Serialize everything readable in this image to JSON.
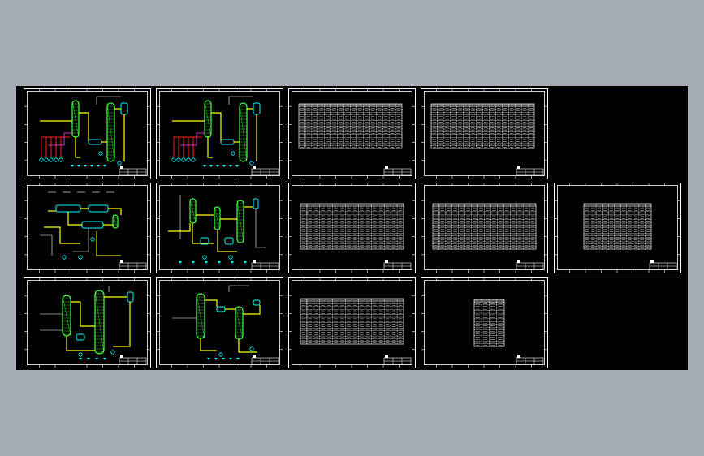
{
  "colors": {
    "background": "#a5acb5",
    "canvas": "#000000",
    "frame": "#ffffff",
    "pipe_yellow": "#ffff00",
    "pipe_red": "#ff2020",
    "vessel_cyan": "#00ffff",
    "equipment_green": "#40ff40",
    "pipe_magenta": "#ff40ff",
    "table_lines": "#ffffff"
  },
  "sheets": [
    {
      "row": 0,
      "col": 0,
      "kind": "pfd",
      "variant": "a"
    },
    {
      "row": 0,
      "col": 1,
      "kind": "pfd",
      "variant": "a"
    },
    {
      "row": 0,
      "col": 2,
      "kind": "table",
      "table": "wide"
    },
    {
      "row": 0,
      "col": 3,
      "kind": "table",
      "table": "wide"
    },
    {
      "row": 1,
      "col": 0,
      "kind": "pfd",
      "variant": "b"
    },
    {
      "row": 1,
      "col": 1,
      "kind": "pfd",
      "variant": "c"
    },
    {
      "row": 1,
      "col": 2,
      "kind": "table",
      "table": "full"
    },
    {
      "row": 1,
      "col": 3,
      "kind": "table",
      "table": "full"
    },
    {
      "row": 1,
      "col": 4,
      "kind": "table",
      "table": "medium"
    },
    {
      "row": 2,
      "col": 0,
      "kind": "pfd",
      "variant": "d"
    },
    {
      "row": 2,
      "col": 1,
      "kind": "pfd",
      "variant": "e"
    },
    {
      "row": 2,
      "col": 2,
      "kind": "table",
      "table": "full"
    },
    {
      "row": 2,
      "col": 3,
      "kind": "table",
      "table": "small"
    }
  ]
}
